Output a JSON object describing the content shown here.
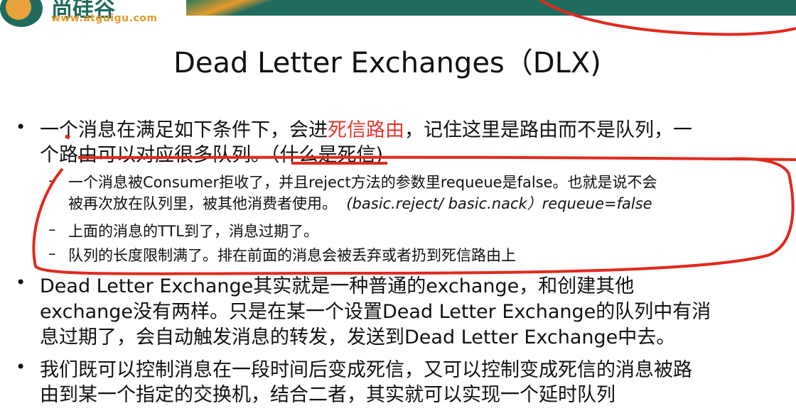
{
  "logo": {
    "cn": "尚硅谷",
    "url": "www.atguigu.com"
  },
  "title": "Dead Letter Exchanges（DLX)",
  "bullets": [
    {
      "line1_pre": "一个消息在满足如下条件下，会进",
      "line1_highlight": "死信路由",
      "line1_post": "，记住这里是路由而不是队列，一",
      "line2": "个路由可以对应很多队列。（什么是死信)",
      "sub": [
        {
          "line1": "一个消息被Consumer拒收了，并且reject方法的参数里requeue是false。也就是说不会",
          "line2_pre": "被再次放在队列里，被其他消费者使用。",
          "line2_italic": "(basic.reject/ basic.nack）requeue=false"
        },
        {
          "line1": "上面的消息的TTL到了，消息过期了。"
        },
        {
          "line1": "队列的长度限制满了。排在前面的消息会被丢弃或者扔到死信路由上"
        }
      ]
    },
    {
      "lines": [
        "Dead Letter Exchange其实就是一种普通的exchange，和创建其他",
        "exchange没有两样。只是在某一个设置Dead Letter Exchange的队列中有消",
        "息过期了，会自动触发消息的转发，发送到Dead Letter Exchange中去。"
      ]
    },
    {
      "lines": [
        "我们既可以控制消息在一段时间后变成死信，又可以控制变成死信的消息被路",
        "由到某一个指定的交换机，结合二者，其实就可以实现一个延时队列"
      ]
    }
  ],
  "colors": {
    "highlight": "#e0362c",
    "annotation": "#e02a1e",
    "brand_teal": "#1f6b5e",
    "brand_orange": "#e59a2a"
  }
}
